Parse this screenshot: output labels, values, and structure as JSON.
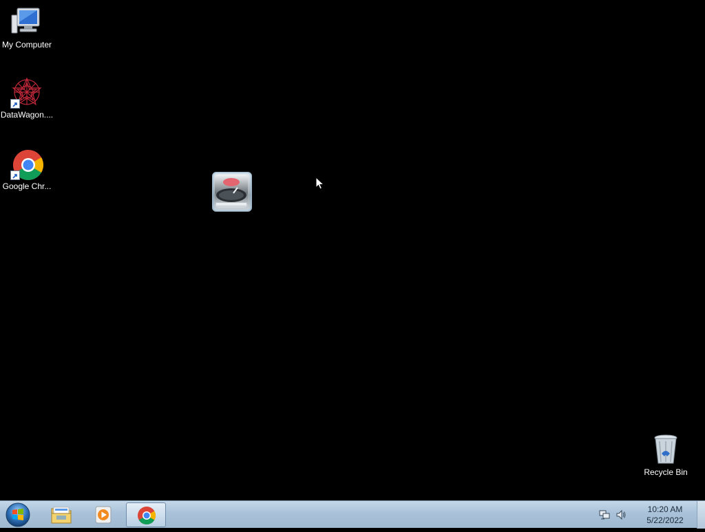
{
  "desktop": {
    "icons": [
      {
        "label": "My Computer",
        "icon": "computer-icon"
      },
      {
        "label": "DataWagon....",
        "icon": "datawagon-icon"
      },
      {
        "label": "Google Chr...",
        "icon": "chrome-icon"
      },
      {
        "label": "Recycle Bin",
        "icon": "recycle-bin-icon"
      }
    ],
    "widget": {
      "icon": "turntable-widget-icon"
    },
    "cursor": {
      "icon": "mouse-pointer-icon"
    }
  },
  "taskbar": {
    "start": {
      "icon": "windows-start-icon"
    },
    "pinned": [
      {
        "name": "Windows Explorer",
        "icon": "folder-icon"
      },
      {
        "name": "Media Player",
        "icon": "media-player-icon"
      },
      {
        "name": "Google Chrome",
        "icon": "chrome-icon",
        "active": true
      }
    ],
    "tray": {
      "network_icon": "network-icon",
      "volume_icon": "volume-icon",
      "time": "10:20 AM",
      "date": "5/22/2022"
    }
  },
  "colors": {
    "desktop_bg": "#000000",
    "taskbar_top": "#c4d7e8",
    "taskbar_bottom": "#9fb9d0"
  }
}
